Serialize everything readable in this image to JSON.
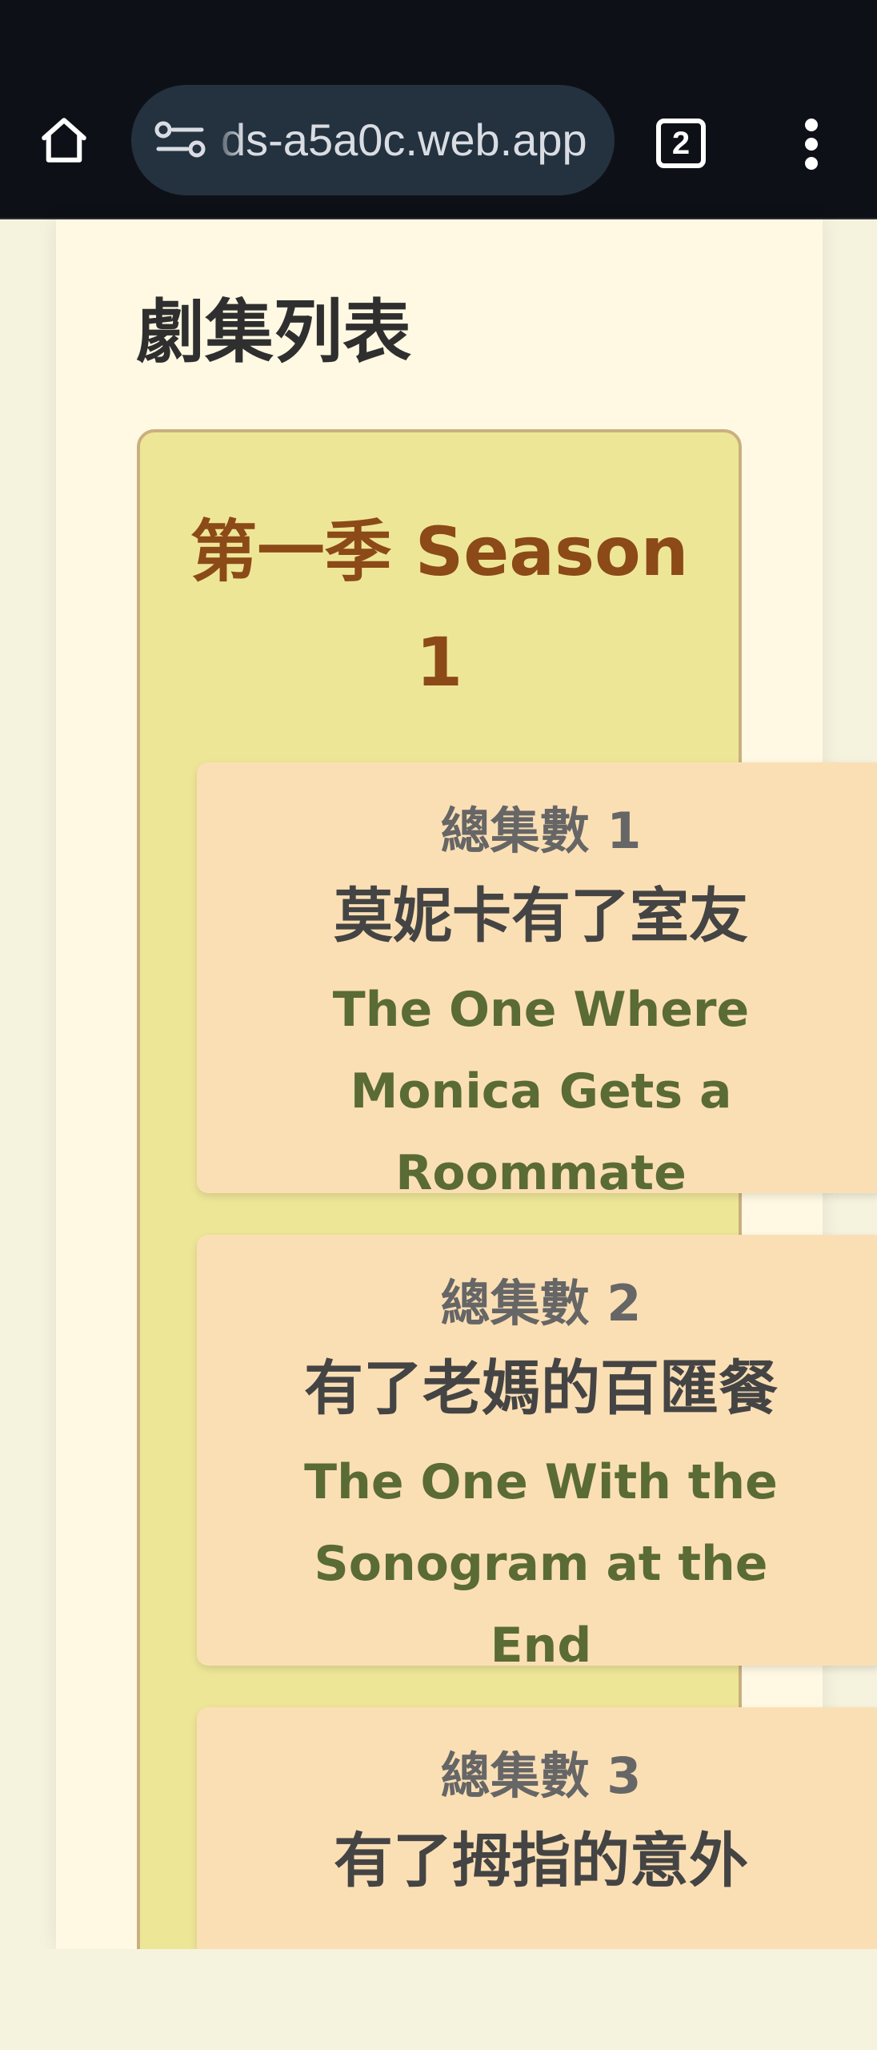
{
  "browser": {
    "url": "ds-a5a0c.web.app",
    "tab_count": "2"
  },
  "page": {
    "title": "劇集列表",
    "season": {
      "title": "第一季 Season 1",
      "episodes": [
        {
          "number_label": "總集數 1",
          "title_zh": "莫妮卡有了室友",
          "title_en": "The One Where Monica Gets a Roommate"
        },
        {
          "number_label": "總集數 2",
          "title_zh": "有了老媽的百匯餐",
          "title_en": "The One With the Sonogram at the End"
        },
        {
          "number_label": "總集數 3",
          "title_zh": "有了拇指的意外",
          "title_en": ""
        }
      ]
    }
  },
  "colors": {
    "season_title": "#8b4a17",
    "episode_en": "#5a6b35",
    "panel_bg": "#eee697",
    "card_bg": "#fbdfb4"
  }
}
